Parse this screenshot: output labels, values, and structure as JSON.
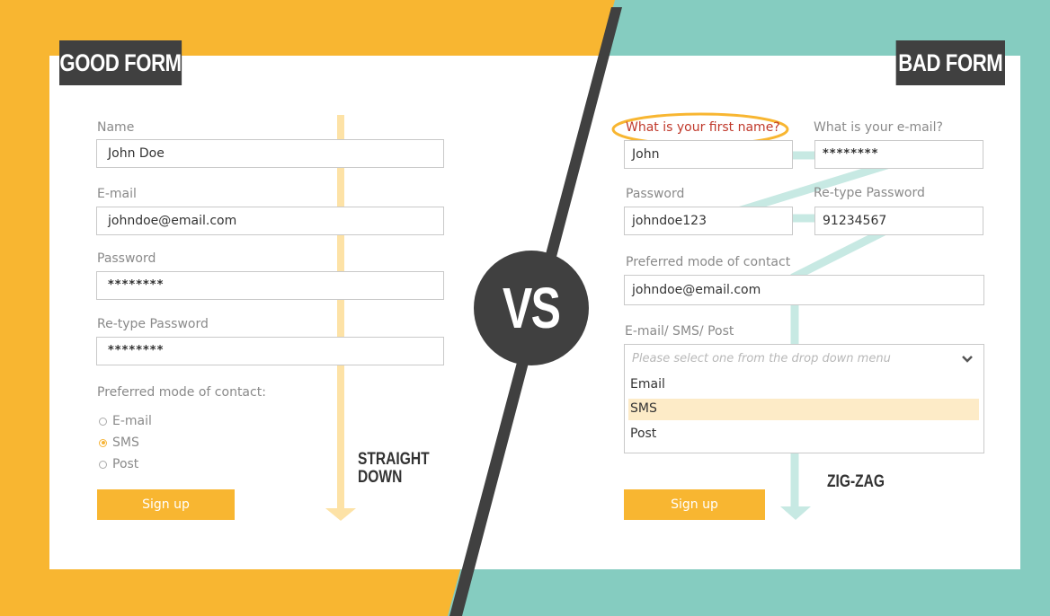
{
  "colors": {
    "good_accent": "#f8b631",
    "bad_accent": "#85ccc0",
    "dark": "#404040",
    "error_red": "#d9432f"
  },
  "good_form": {
    "title": "GOOD FORM",
    "name_label": "Name",
    "name_value": "John Doe",
    "email_label": "E-mail",
    "email_value": "johndoe@email.com",
    "password_label": "Password",
    "password_value": "********",
    "retype_label": "Re-type Password",
    "retype_value": "********",
    "contact_label": "Preferred mode of contact:",
    "options": [
      "E-mail",
      "SMS",
      "Post"
    ],
    "selected_option": "SMS",
    "signup_label": "Sign up",
    "flow_label_line1": "STRAIGHT",
    "flow_label_line2": "DOWN"
  },
  "vs_label": "VS",
  "bad_form": {
    "title": "BAD FORM",
    "first_name_label": "What is your first name?",
    "first_name_value": "John",
    "email_label": "What is your e-mail?",
    "email_value": "********",
    "password_label": "Password",
    "password_value": "johndoe123",
    "retype_label": "Re-type Password",
    "retype_value": "91234567",
    "contact_label": "Preferred mode of contact",
    "contact_value": "johndoe@email.com",
    "method_label": "E-mail/ SMS/ Post",
    "dropdown_placeholder": "Please select one from the drop down menu",
    "dropdown_options": [
      "Email",
      "SMS",
      "Post"
    ],
    "highlighted_option": "SMS",
    "signup_label": "Sign up",
    "flow_label": "ZIG-ZAG"
  }
}
